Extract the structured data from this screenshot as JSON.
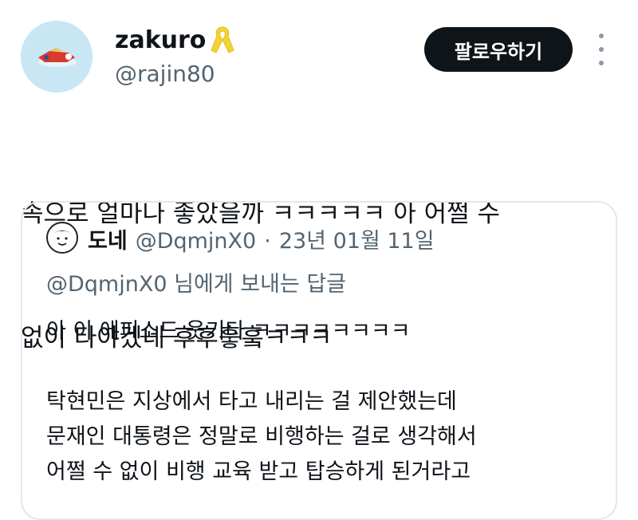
{
  "author": {
    "name": "zakuro",
    "handle": "@rajin80",
    "badge_icon": "yellow-ribbon-icon",
    "badge_color": "#f2d335",
    "avatar_bg": "#c9e6f5"
  },
  "follow_button": {
    "label": "팔로우하기",
    "bg": "#0f1419"
  },
  "tweet": {
    "lines": [
      "속으로 얼마나 좋았을까 ㅋㅋㅋㅋㅋ 아 어쩔 수",
      "없이 타야겠네 후후훟훜ㅋㅋㅋ"
    ]
  },
  "quote": {
    "name": "도네",
    "handle": "@DqmjnX0",
    "separator": "·",
    "date": "23년 01월 11일",
    "reply_to_handle": "@DqmjnX0",
    "reply_to_suffix": "님에게 보내는 답글",
    "paragraphs": [
      "아 이 에피소드 웃기다 ㅋㅋㅋㅋㅋㅋㅋㅋ",
      "탁현민은 지상에서 타고 내리는 걸 제안했는데\n문재인 대통령은 정말로 비행하는 걸로 생각해서\n어쩔 수 없이 비행 교육 받고 탑승하게 된거라고"
    ]
  }
}
